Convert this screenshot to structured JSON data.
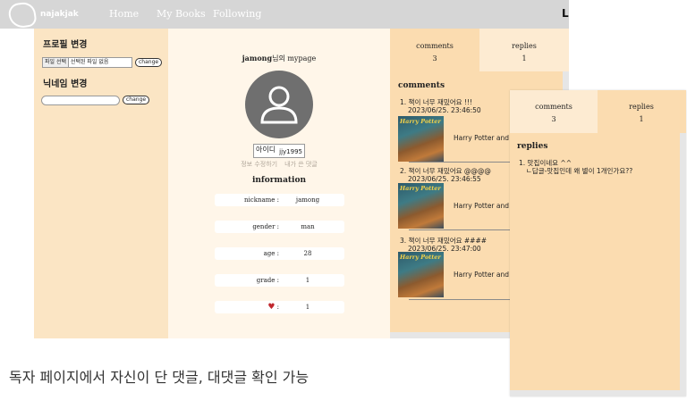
{
  "nav": {
    "logo": "najakjak",
    "links": [
      "Home",
      "My Books",
      "Following"
    ],
    "right_mark": "L"
  },
  "settings": {
    "profile_title": "프로필 변경",
    "file_button": "파일 선택",
    "file_status": "선택된 파일 없음",
    "change_label": "change",
    "nickname_title": "닉네임 변경",
    "nickname_value": "",
    "nickname_change_label": "change"
  },
  "profile": {
    "owner": "jamong",
    "title_suffix": "님의 mypage",
    "id_label": "아이디",
    "id_value": "jjy1995",
    "edit_link": "정보 수정하기",
    "my_comments_link": "내가 쓴 댓글",
    "info_title": "information",
    "info": [
      {
        "key": "nickname :",
        "value": "jamong"
      },
      {
        "key": "gender :",
        "value": "man"
      },
      {
        "key": "age :",
        "value": "28"
      },
      {
        "key": "grade :",
        "value": "1"
      },
      {
        "key": ":",
        "value": "1",
        "icon": "heart-icon"
      }
    ]
  },
  "tabs": {
    "comments_label": "comments",
    "comments_count": "3",
    "replies_label": "replies",
    "replies_count": "1"
  },
  "comments": {
    "title": "comments",
    "items": [
      {
        "num": "1.",
        "text": "책이 너무 재밌어요 !!!",
        "date": "2023/06/25. 23:46:50",
        "book": "Harry Potter and",
        "cover_logo": "Harry Potter"
      },
      {
        "num": "2.",
        "text": "책이 너무 재밌어요 @@@@",
        "date": "2023/06/25. 23:46:55",
        "book": "Harry Potter and",
        "cover_logo": "Harry Potter"
      },
      {
        "num": "3.",
        "text": "책이 너무 재밌어요 ####",
        "date": "2023/06/25. 23:47:00",
        "book": "Harry Potter and",
        "cover_logo": "Harry Potter"
      }
    ]
  },
  "replies_panel": {
    "comments_label": "comments",
    "comments_count": "3",
    "replies_label": "replies",
    "replies_count": "1",
    "title": "replies",
    "items": [
      {
        "num": "1.",
        "text": "맛집이네요 ^^",
        "sub": "ㄴ답글-맛집인데 왜 별이 1개인가요??"
      }
    ]
  },
  "caption": "독자 페이지에서 자신이 단 댓글, 대댓글 확인 가능",
  "colors": {
    "nav_bg": "#d6d6d6",
    "left_bg": "#fbe5c4",
    "center_bg": "#fff6e9",
    "right_bg": "#fbdcb0",
    "tab_inactive_bg": "#fdebd2",
    "avatar_bg": "#6f6f6f",
    "heart": "#c0272d"
  }
}
